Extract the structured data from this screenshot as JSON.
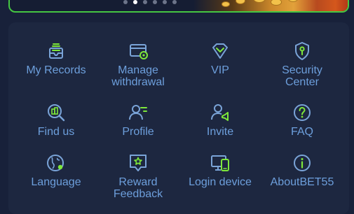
{
  "carousel": {
    "slide_count": 6,
    "active_index": 1
  },
  "colors": {
    "icon_outline": "#7aa4d8",
    "icon_accent": "#7ee83a",
    "label": "#6d9fdc",
    "panel": "#1d2740",
    "background": "#18213a"
  },
  "menu": [
    {
      "label": "My Records",
      "icon": "records-icon"
    },
    {
      "label": "Manage\nwithdrawal",
      "icon": "withdrawal-card-icon"
    },
    {
      "label": "VIP",
      "icon": "vip-diamond-icon"
    },
    {
      "label": "Security\nCenter",
      "icon": "security-key-icon"
    },
    {
      "label": "Find us",
      "icon": "find-us-icon"
    },
    {
      "label": "Profile",
      "icon": "profile-icon"
    },
    {
      "label": "Invite",
      "icon": "invite-icon"
    },
    {
      "label": "FAQ",
      "icon": "faq-icon"
    },
    {
      "label": "Language",
      "icon": "language-globe-icon"
    },
    {
      "label": "Reward\nFeedback",
      "icon": "reward-feedback-icon"
    },
    {
      "label": "Login device",
      "icon": "login-device-icon"
    },
    {
      "label": "AboutBET55",
      "icon": "about-info-icon"
    }
  ]
}
